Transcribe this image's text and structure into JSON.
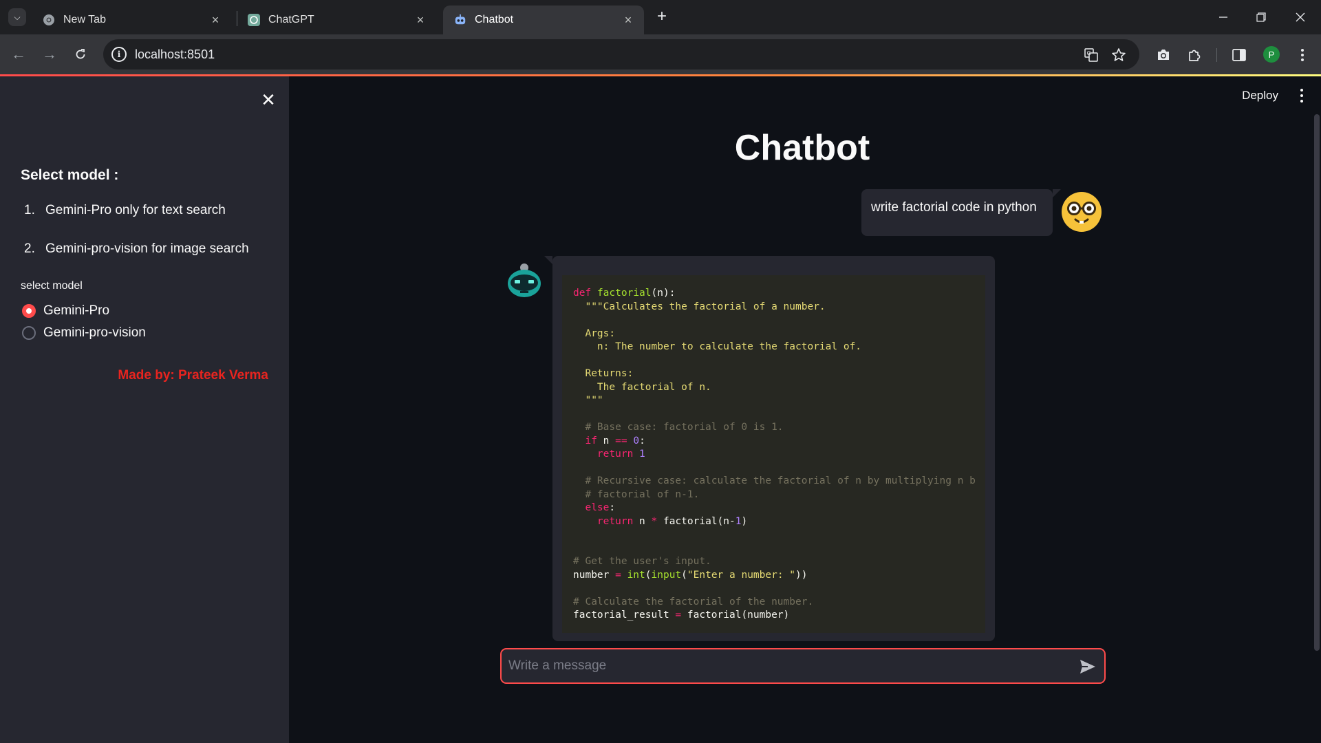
{
  "browser": {
    "tabs": [
      {
        "title": "New Tab",
        "icon": "chrome-icon"
      },
      {
        "title": "ChatGPT",
        "icon": "openai-icon"
      },
      {
        "title": "Chatbot",
        "icon": "robot-icon",
        "active": true
      }
    ],
    "url": "localhost:8501",
    "profile_initial": "P"
  },
  "app": {
    "deploy_label": "Deploy",
    "title": "Chatbot",
    "accent_color": "#ff4b4b"
  },
  "sidebar": {
    "heading": "Select model :",
    "list": [
      {
        "num": "1.",
        "text": "Gemini-Pro only for text search"
      },
      {
        "num": "2.",
        "text": "Gemini-pro-vision for image search"
      }
    ],
    "radio_label": "select model",
    "radio_options": [
      "Gemini-Pro",
      "Gemini-pro-vision"
    ],
    "selected_option": "Gemini-Pro",
    "credit": "Made by: Prateek Verma"
  },
  "chat": {
    "user_message": "write factorial code in python",
    "code_lines": [
      "def factorial(n):",
      "  \"\"\"Calculates the factorial of a number.",
      "",
      "  Args:",
      "    n: The number to calculate the factorial of.",
      "",
      "  Returns:",
      "    The factorial of n.",
      "  \"\"\"",
      "",
      "  # Base case: factorial of 0 is 1.",
      "  if n == 0:",
      "    return 1",
      "",
      "  # Recursive case: calculate the factorial of n by multiplying n b",
      "  # factorial of n-1.",
      "  else:",
      "    return n * factorial(n-1)",
      "",
      "",
      "# Get the user's input.",
      "number = int(input(\"Enter a number: \"))",
      "",
      "# Calculate the factorial of the number.",
      "factorial_result = factorial(number)"
    ],
    "input_placeholder": "Write a message"
  }
}
